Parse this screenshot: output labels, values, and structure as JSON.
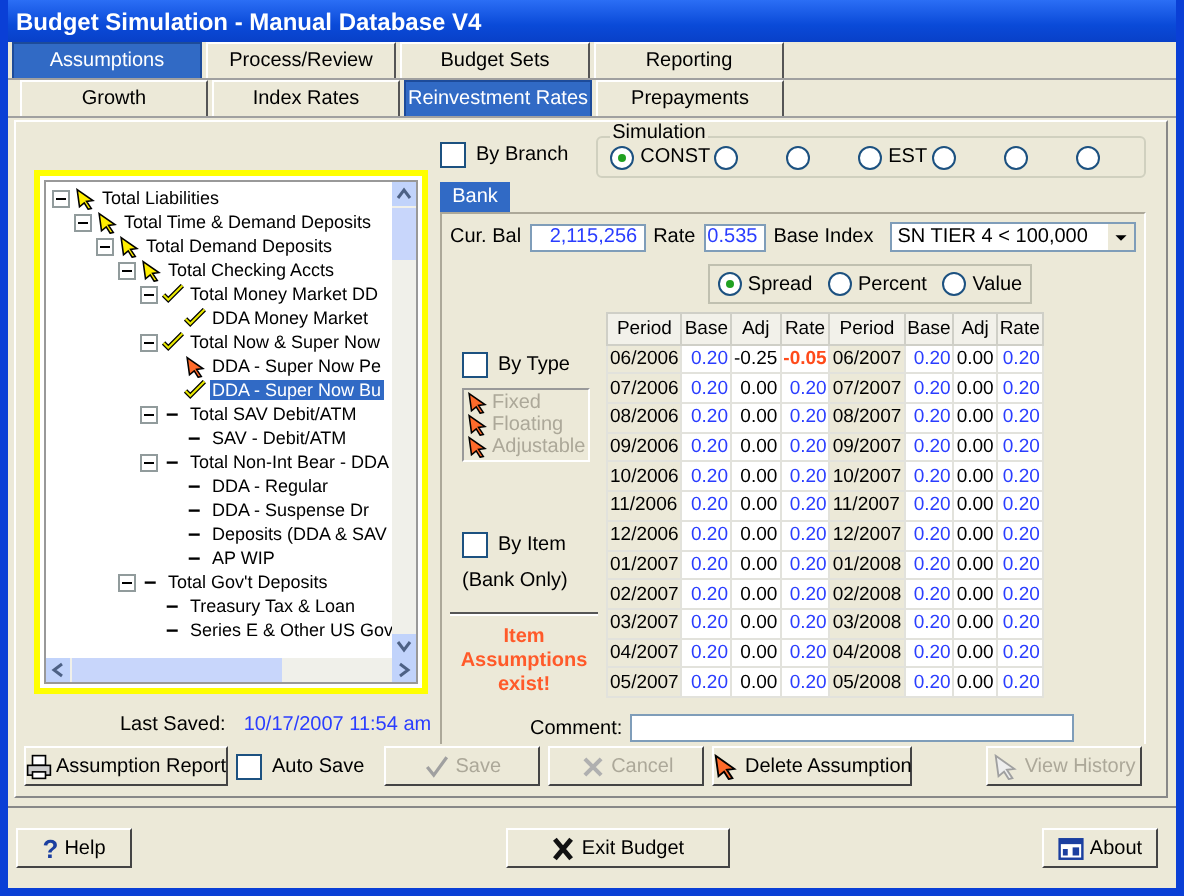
{
  "window": {
    "title": "Budget Simulation - Manual Database V4"
  },
  "tabs": [
    {
      "label": "Assumptions",
      "selected": true
    },
    {
      "label": "Process/Review",
      "selected": false
    },
    {
      "label": "Budget Sets",
      "selected": false
    },
    {
      "label": "Reporting",
      "selected": false
    }
  ],
  "subtabs": [
    {
      "label": "Growth",
      "selected": false
    },
    {
      "label": "Index Rates",
      "selected": false
    },
    {
      "label": "Reinvestment Rates",
      "selected": true
    },
    {
      "label": "Prepayments",
      "selected": false
    }
  ],
  "tree": [
    {
      "label": "Total Liabilities",
      "kind": "pointer",
      "expanded": true,
      "children": [
        {
          "label": "Total Time & Demand Deposits",
          "kind": "pointer",
          "expanded": true,
          "children": [
            {
              "label": "Total Demand Deposits",
              "kind": "pointer",
              "expanded": true,
              "children": [
                {
                  "label": "Total Checking Accts",
                  "kind": "pointer",
                  "expanded": true,
                  "children": [
                    {
                      "label": "Total Money Market DD",
                      "kind": "check",
                      "expanded": true,
                      "children": [
                        {
                          "label": "DDA Money Market",
                          "kind": "check",
                          "selected": false
                        }
                      ]
                    },
                    {
                      "label": "Total Now & Super Now",
                      "kind": "check",
                      "expanded": true,
                      "children": [
                        {
                          "label": "DDA - Super Now Pe",
                          "kind": "alert",
                          "selected": false
                        },
                        {
                          "label": "DDA - Super Now Bu",
                          "kind": "check",
                          "selected": true
                        }
                      ]
                    },
                    {
                      "label": "Total SAV Debit/ATM",
                      "kind": "dash",
                      "expanded": true,
                      "children": [
                        {
                          "label": "SAV - Debit/ATM",
                          "kind": "dash",
                          "selected": false
                        }
                      ]
                    },
                    {
                      "label": "Total Non-Int Bear - DDA",
                      "kind": "dash",
                      "expanded": true,
                      "children": [
                        {
                          "label": "DDA - Regular",
                          "kind": "dash",
                          "selected": false
                        },
                        {
                          "label": "DDA - Suspense Dr",
                          "kind": "dash",
                          "selected": false
                        },
                        {
                          "label": "Deposits (DDA & SAV",
                          "kind": "dash",
                          "selected": false
                        },
                        {
                          "label": "AP WIP",
                          "kind": "dash",
                          "selected": false
                        }
                      ]
                    }
                  ]
                },
                {
                  "label": "Total Gov't Deposits",
                  "kind": "dash",
                  "expanded": true,
                  "children": [
                    {
                      "label": "Treasury Tax & Loan",
                      "kind": "dash",
                      "selected": false
                    },
                    {
                      "label": "Series E & Other US Gov",
                      "kind": "dash",
                      "selected": false
                    }
                  ]
                }
              ]
            }
          ]
        }
      ]
    }
  ],
  "by_branch": {
    "label": "By Branch",
    "checked": false
  },
  "simulation": {
    "title": "Simulation",
    "options": [
      {
        "label": "CONST",
        "selected": true
      },
      {
        "selected": false
      },
      {
        "selected": false
      },
      {
        "label": "EST",
        "selected": false
      },
      {
        "selected": false
      },
      {
        "selected": false
      },
      {
        "selected": false
      }
    ]
  },
  "bank_tab": {
    "label": "Bank",
    "selected": true
  },
  "cur_bal": {
    "label": "Cur. Bal",
    "value": "2,115,256"
  },
  "rate": {
    "label": "Rate",
    "value": "0.535"
  },
  "base_index": {
    "label": "Base Index",
    "value": "SN TIER 4 < 100,000"
  },
  "mode": [
    {
      "label": "Spread",
      "selected": true
    },
    {
      "label": "Percent",
      "selected": false
    },
    {
      "label": "Value",
      "selected": false
    }
  ],
  "by_type": {
    "label": "By Type",
    "checked": false,
    "types": [
      {
        "label": "Fixed",
        "disabled": true
      },
      {
        "label": "Floating",
        "disabled": true
      },
      {
        "label": "Adjustable",
        "disabled": true
      }
    ]
  },
  "by_item": {
    "label": "By Item",
    "checked": false,
    "note": "(Bank Only)"
  },
  "warning": "Item Assumptions exist!",
  "table": {
    "columns": [
      {
        "label": "Period",
        "kind": "period"
      },
      {
        "label": "Base",
        "kind": "value"
      },
      {
        "label": "Adj",
        "kind": "adj"
      },
      {
        "label": "Rate",
        "kind": "value"
      },
      {
        "label": "Period",
        "kind": "period"
      },
      {
        "label": "Base",
        "kind": "value"
      },
      {
        "label": "Adj",
        "kind": "adj"
      },
      {
        "label": "Rate",
        "kind": "value"
      }
    ],
    "rows": [
      {
        "cells": [
          "06/2006",
          "0.20",
          "-0.25",
          "-0.05",
          "06/2007",
          "0.20",
          "0.00",
          "0.20"
        ],
        "alert": true
      },
      {
        "cells": [
          "07/2006",
          "0.20",
          "0.00",
          "0.20",
          "07/2007",
          "0.20",
          "0.00",
          "0.20"
        ],
        "alert": false
      },
      {
        "cells": [
          "08/2006",
          "0.20",
          "0.00",
          "0.20",
          "08/2007",
          "0.20",
          "0.00",
          "0.20"
        ],
        "alert": false
      },
      {
        "cells": [
          "09/2006",
          "0.20",
          "0.00",
          "0.20",
          "09/2007",
          "0.20",
          "0.00",
          "0.20"
        ],
        "alert": false
      },
      {
        "cells": [
          "10/2006",
          "0.20",
          "0.00",
          "0.20",
          "10/2007",
          "0.20",
          "0.00",
          "0.20"
        ],
        "alert": false
      },
      {
        "cells": [
          "11/2006",
          "0.20",
          "0.00",
          "0.20",
          "11/2007",
          "0.20",
          "0.00",
          "0.20"
        ],
        "alert": false
      },
      {
        "cells": [
          "12/2006",
          "0.20",
          "0.00",
          "0.20",
          "12/2007",
          "0.20",
          "0.00",
          "0.20"
        ],
        "alert": false
      },
      {
        "cells": [
          "01/2007",
          "0.20",
          "0.00",
          "0.20",
          "01/2008",
          "0.20",
          "0.00",
          "0.20"
        ],
        "alert": false
      },
      {
        "cells": [
          "02/2007",
          "0.20",
          "0.00",
          "0.20",
          "02/2008",
          "0.20",
          "0.00",
          "0.20"
        ],
        "alert": false
      },
      {
        "cells": [
          "03/2007",
          "0.20",
          "0.00",
          "0.20",
          "03/2008",
          "0.20",
          "0.00",
          "0.20"
        ],
        "alert": false
      },
      {
        "cells": [
          "04/2007",
          "0.20",
          "0.00",
          "0.20",
          "04/2008",
          "0.20",
          "0.00",
          "0.20"
        ],
        "alert": false
      },
      {
        "cells": [
          "05/2007",
          "0.20",
          "0.00",
          "0.20",
          "05/2008",
          "0.20",
          "0.00",
          "0.20"
        ],
        "alert": false
      }
    ]
  },
  "comment": {
    "label": "Comment:"
  },
  "last_saved": {
    "label": "Last Saved:",
    "value": "10/17/2007 11:54 am"
  },
  "auto_save": {
    "label": "Auto Save",
    "checked": false
  },
  "actions": [
    {
      "label": "Assumption Report",
      "kind": "report",
      "disabled": false
    },
    {
      "label": "Save",
      "kind": "save",
      "disabled": true
    },
    {
      "label": "Cancel",
      "kind": "cancel",
      "disabled": true
    },
    {
      "label": "Delete Assumption",
      "kind": "delete",
      "disabled": false
    },
    {
      "label": "View History",
      "kind": "history",
      "disabled": true
    }
  ],
  "footer": [
    {
      "label": "Help",
      "kind": "help",
      "glyph": "?"
    },
    {
      "label": "Exit Budget",
      "kind": "exit"
    },
    {
      "label": "About",
      "kind": "about"
    }
  ]
}
